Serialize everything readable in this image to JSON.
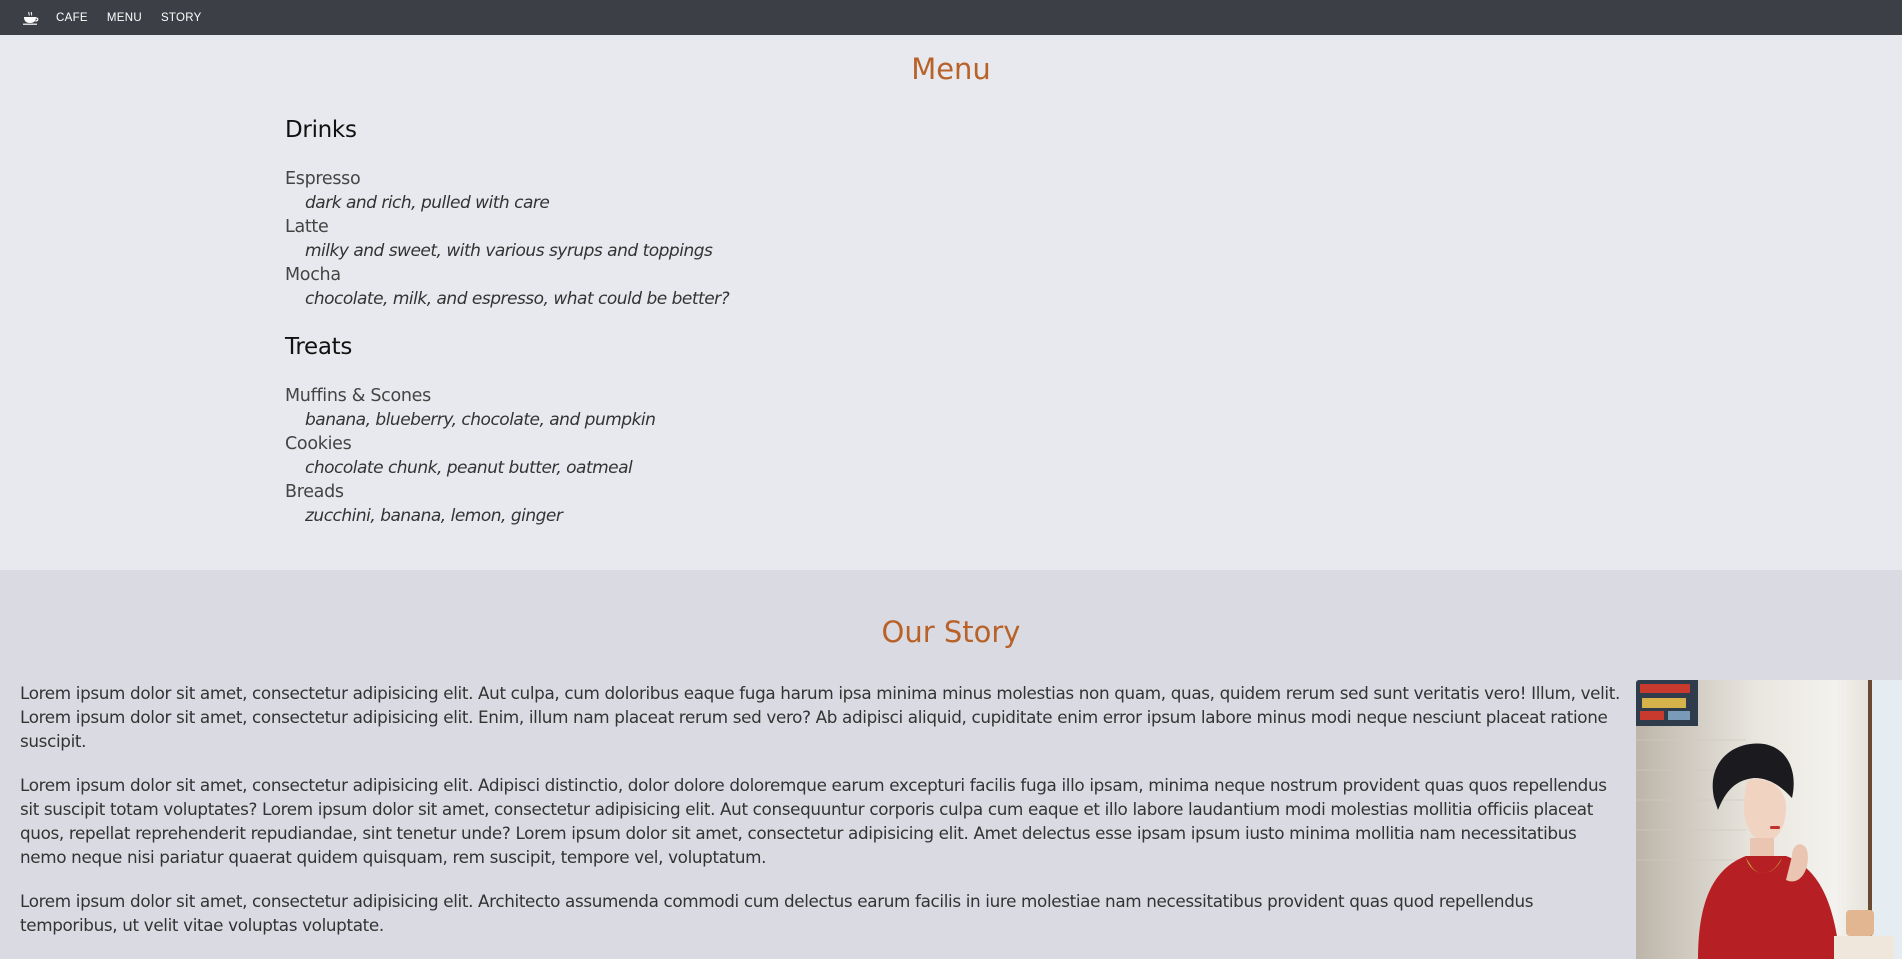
{
  "nav": {
    "logo_icon": "coffee-cup-icon",
    "links": [
      "CAFE",
      "MENU",
      "STORY"
    ]
  },
  "menu": {
    "title": "Menu",
    "categories": [
      {
        "heading": "Drinks",
        "items": [
          {
            "name": "Espresso",
            "description": "dark and rich, pulled with care"
          },
          {
            "name": "Latte",
            "description": "milky and sweet, with various syrups and toppings"
          },
          {
            "name": "Mocha",
            "description": "chocolate, milk, and espresso, what could be better?"
          }
        ]
      },
      {
        "heading": "Treats",
        "items": [
          {
            "name": "Muffins & Scones",
            "description": "banana, blueberry, chocolate, and pumpkin"
          },
          {
            "name": "Cookies",
            "description": "chocolate chunk, peanut butter, oatmeal"
          },
          {
            "name": "Breads",
            "description": "zucchini, banana, lemon, ginger"
          }
        ]
      }
    ]
  },
  "story": {
    "title": "Our Story",
    "paragraphs": [
      "Lorem ipsum dolor sit amet, consectetur adipisicing elit. Aut culpa, cum doloribus eaque fuga harum ipsa minima minus molestias non quam, quas, quidem rerum sed sunt veritatis vero! Illum, velit. Lorem ipsum dolor sit amet, consectetur adipisicing elit. Enim, illum nam placeat rerum sed vero? Ab adipisci aliquid, cupiditate enim error ipsum labore minus modi neque nesciunt placeat ratione suscipit.",
      "Lorem ipsum dolor sit amet, consectetur adipisicing elit. Adipisci distinctio, dolor dolore doloremque earum excepturi facilis fuga illo ipsam, minima neque nostrum provident quas quos repellendus sit suscipit totam voluptates? Lorem ipsum dolor sit amet, consectetur adipisicing elit. Aut consequuntur corporis culpa cum eaque et illo labore laudantium modi molestias mollitia officiis placeat quos, repellat reprehenderit repudiandae, sint tenetur unde? Lorem ipsum dolor sit amet, consectetur adipisicing elit. Amet delectus esse ipsam ipsum iusto minima mollitia nam necessitatibus nemo neque nisi pariatur quaerat quidem quisquam, rem suscipit, tempore vel, voluptatum.",
      "Lorem ipsum dolor sit amet, consectetur adipisicing elit. Architecto assumenda commodi cum delectus earum facilis in iure molestiae nam necessitatibus provident quas quod repellendus temporibus, ut velit vitae voluptas voluptate."
    ],
    "photo_icon": "woman-at-cafe-photo"
  },
  "colors": {
    "nav_bg": "#3c4046",
    "heading_accent": "#b8622a",
    "menu_bg": "#e8e9ee",
    "story_bg": "#dadbe2"
  }
}
